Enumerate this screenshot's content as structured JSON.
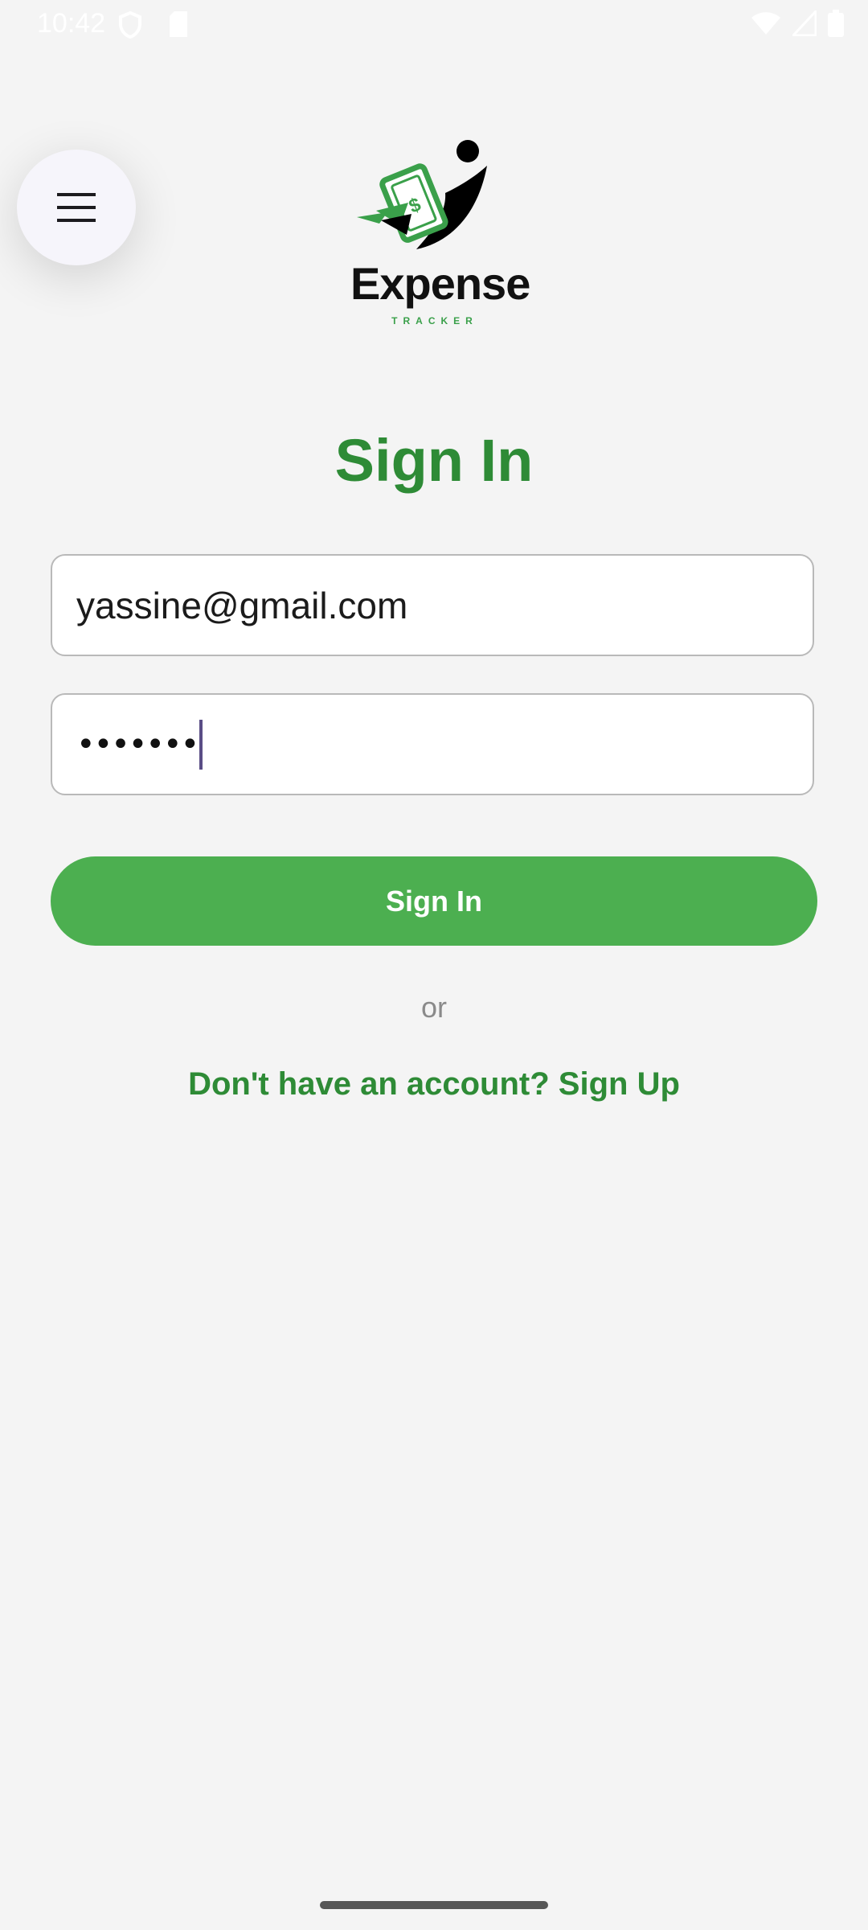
{
  "status_bar": {
    "time": "10:42",
    "icons_left": [
      "shield-icon",
      "sd-card-icon"
    ],
    "icons_right": [
      "wifi-icon",
      "signal-icon",
      "battery-icon"
    ]
  },
  "menu_button": {
    "icon": "hamburger-menu-icon"
  },
  "logo": {
    "word": "Expense",
    "sub": "TRACKER",
    "accent": "#3aa04a"
  },
  "page": {
    "title": "Sign In"
  },
  "form": {
    "email_value": "yassine@gmail.com",
    "password_mask": "•••••••"
  },
  "actions": {
    "sign_in_label": "Sign In",
    "or_label": "or",
    "signup_link": "Don't have an account? Sign Up"
  },
  "colors": {
    "primary": "#4caf50",
    "title_green": "#2e8b36",
    "background": "#f4f4f4"
  }
}
